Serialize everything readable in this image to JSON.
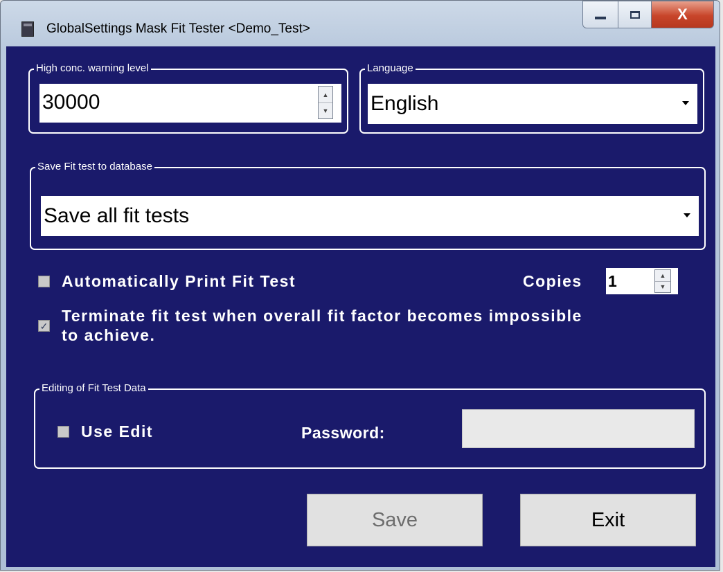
{
  "window": {
    "title": "GlobalSettings Mask Fit Tester <Demo_Test>",
    "icons": {
      "app": "app-window-icon",
      "minimize": "minimize-icon",
      "maximize": "maximize-icon",
      "close": "close-icon"
    },
    "close_glyph": "X"
  },
  "warning_level": {
    "legend": "High conc. warning level",
    "value": "30000"
  },
  "language": {
    "legend": "Language",
    "selected": "English"
  },
  "save_fit_test": {
    "legend": "Save Fit test to database",
    "selected": "Save all fit tests"
  },
  "auto_print": {
    "label": "Automatically Print Fit Test",
    "checked": false,
    "copies_label": "Copies",
    "copies_value": "1"
  },
  "terminate": {
    "line1": "Terminate fit test when overall fit factor becomes impossible",
    "line2": "to achieve.",
    "checked": true,
    "check_glyph": "✓"
  },
  "editing": {
    "legend": "Editing of Fit Test Data",
    "use_edit_label": "Use Edit",
    "use_edit_checked": false,
    "password_label": "Password:",
    "password_value": ""
  },
  "buttons": {
    "save": "Save",
    "exit": "Exit"
  },
  "colors": {
    "client_bg": "#1a1a6b",
    "close_button": "#c8452a"
  }
}
